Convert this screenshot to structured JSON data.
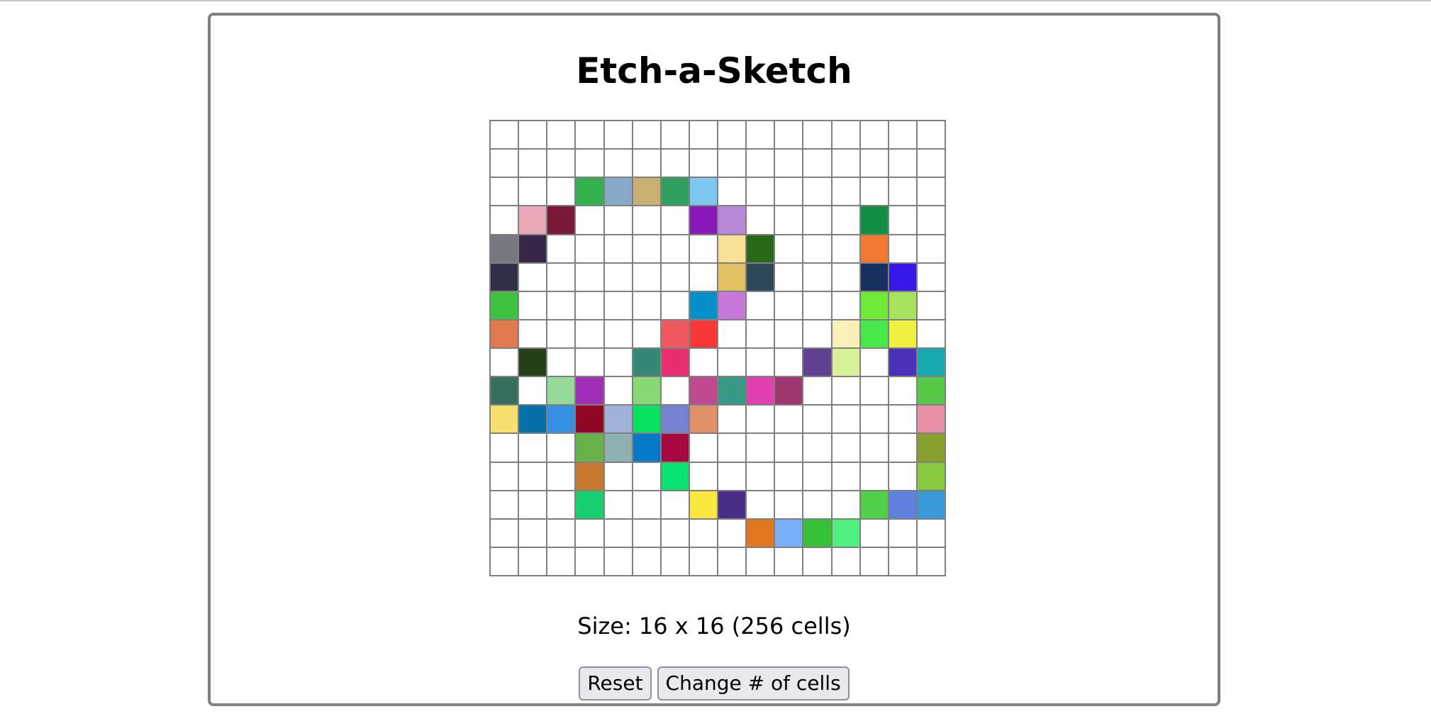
{
  "app": {
    "title": "Etch-a-Sketch",
    "size_label": "Size: 16 x 16 (256 cells)",
    "buttons": {
      "reset": "Reset",
      "change_cells": "Change # of cells"
    }
  },
  "grid": {
    "columns": 16,
    "rows": 16,
    "border_color": "#808080",
    "blank_color": "#ffffff",
    "painted_cells": [
      [
        2,
        3,
        "#34b050"
      ],
      [
        2,
        4,
        "#88a8c8"
      ],
      [
        2,
        5,
        "#c8b070"
      ],
      [
        2,
        6,
        "#30a060"
      ],
      [
        2,
        7,
        "#80c8f0"
      ],
      [
        3,
        1,
        "#e8a8b8"
      ],
      [
        3,
        2,
        "#7a1838"
      ],
      [
        3,
        7,
        "#8818b8"
      ],
      [
        3,
        8,
        "#b888d8"
      ],
      [
        3,
        13,
        "#109040"
      ],
      [
        4,
        0,
        "#787880"
      ],
      [
        4,
        1,
        "#382848"
      ],
      [
        4,
        8,
        "#f8e098"
      ],
      [
        4,
        9,
        "#286818"
      ],
      [
        4,
        13,
        "#f07830"
      ],
      [
        5,
        0,
        "#303048"
      ],
      [
        5,
        8,
        "#e0c060"
      ],
      [
        5,
        9,
        "#304858"
      ],
      [
        5,
        13,
        "#183060"
      ],
      [
        5,
        14,
        "#3818e8"
      ],
      [
        6,
        0,
        "#40c040"
      ],
      [
        6,
        7,
        "#0890c8"
      ],
      [
        6,
        8,
        "#c878d8"
      ],
      [
        6,
        13,
        "#70e838"
      ],
      [
        6,
        14,
        "#a8e060"
      ],
      [
        7,
        0,
        "#e07850"
      ],
      [
        7,
        6,
        "#f05860"
      ],
      [
        7,
        7,
        "#f83838"
      ],
      [
        7,
        12,
        "#f8f0b8"
      ],
      [
        7,
        13,
        "#48e848"
      ],
      [
        7,
        14,
        "#f0f040"
      ],
      [
        8,
        1,
        "#284018"
      ],
      [
        8,
        5,
        "#388878"
      ],
      [
        8,
        6,
        "#e83070"
      ],
      [
        8,
        11,
        "#604090"
      ],
      [
        8,
        12,
        "#d8f098"
      ],
      [
        8,
        14,
        "#4830b8"
      ],
      [
        8,
        15,
        "#18a8b0"
      ],
      [
        9,
        0,
        "#387060"
      ],
      [
        9,
        2,
        "#98d898"
      ],
      [
        9,
        3,
        "#a030b8"
      ],
      [
        9,
        5,
        "#88d878"
      ],
      [
        9,
        7,
        "#c04890"
      ],
      [
        9,
        8,
        "#389888"
      ],
      [
        9,
        9,
        "#e040b0"
      ],
      [
        9,
        10,
        "#a03870"
      ],
      [
        9,
        15,
        "#58c848"
      ],
      [
        10,
        0,
        "#f8e070"
      ],
      [
        10,
        1,
        "#0870a8"
      ],
      [
        10,
        2,
        "#3890e0"
      ],
      [
        10,
        3,
        "#900828"
      ],
      [
        10,
        4,
        "#a0b0d8"
      ],
      [
        10,
        5,
        "#08e060"
      ],
      [
        10,
        6,
        "#7880d0"
      ],
      [
        10,
        7,
        "#e09068"
      ],
      [
        10,
        15,
        "#e890a8"
      ],
      [
        11,
        3,
        "#68b048"
      ],
      [
        11,
        4,
        "#90b0b0"
      ],
      [
        11,
        5,
        "#0878c8"
      ],
      [
        11,
        6,
        "#a80840"
      ],
      [
        11,
        15,
        "#88a030"
      ],
      [
        12,
        3,
        "#c87830"
      ],
      [
        12,
        6,
        "#08e070"
      ],
      [
        12,
        15,
        "#88c840"
      ],
      [
        13,
        3,
        "#18d070"
      ],
      [
        13,
        7,
        "#f8e840"
      ],
      [
        13,
        8,
        "#483088"
      ],
      [
        13,
        13,
        "#50d048"
      ],
      [
        13,
        14,
        "#6080e0"
      ],
      [
        13,
        15,
        "#3898d8"
      ],
      [
        14,
        9,
        "#e07820"
      ],
      [
        14,
        10,
        "#78b0f8"
      ],
      [
        14,
        11,
        "#38c038"
      ],
      [
        14,
        12,
        "#50f080"
      ]
    ]
  }
}
